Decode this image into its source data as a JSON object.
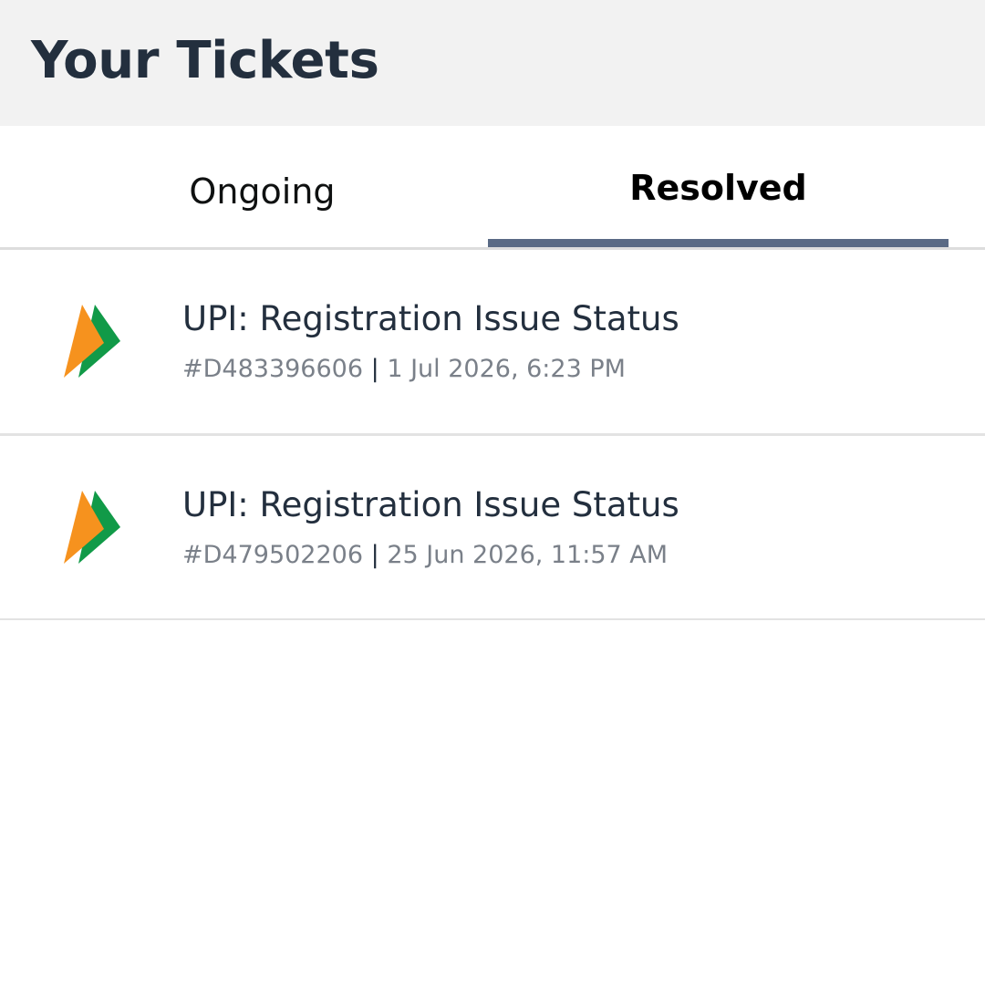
{
  "header": {
    "title": "Your Tickets"
  },
  "tabs": [
    {
      "label": "Ongoing",
      "selected": false
    },
    {
      "label": "Resolved",
      "selected": true
    }
  ],
  "tickets": [
    {
      "icon": "upi-logo-icon",
      "title": "UPI: Registration Issue Status",
      "id": "#D483396606",
      "separator": "|",
      "datetime": "1 Jul 2026, 6:23 PM"
    },
    {
      "icon": "upi-logo-icon",
      "title": "UPI: Registration Issue Status",
      "id": "#D479502206",
      "separator": "|",
      "datetime": "25 Jun 2026, 11:57 AM"
    }
  ],
  "colors": {
    "header_bg": "#f2f2f2",
    "title_text": "#232f3e",
    "tab_indicator": "#5a6a85",
    "meta_text": "#7a8089",
    "upi_orange": "#f6921e",
    "upi_green": "#119a48"
  }
}
